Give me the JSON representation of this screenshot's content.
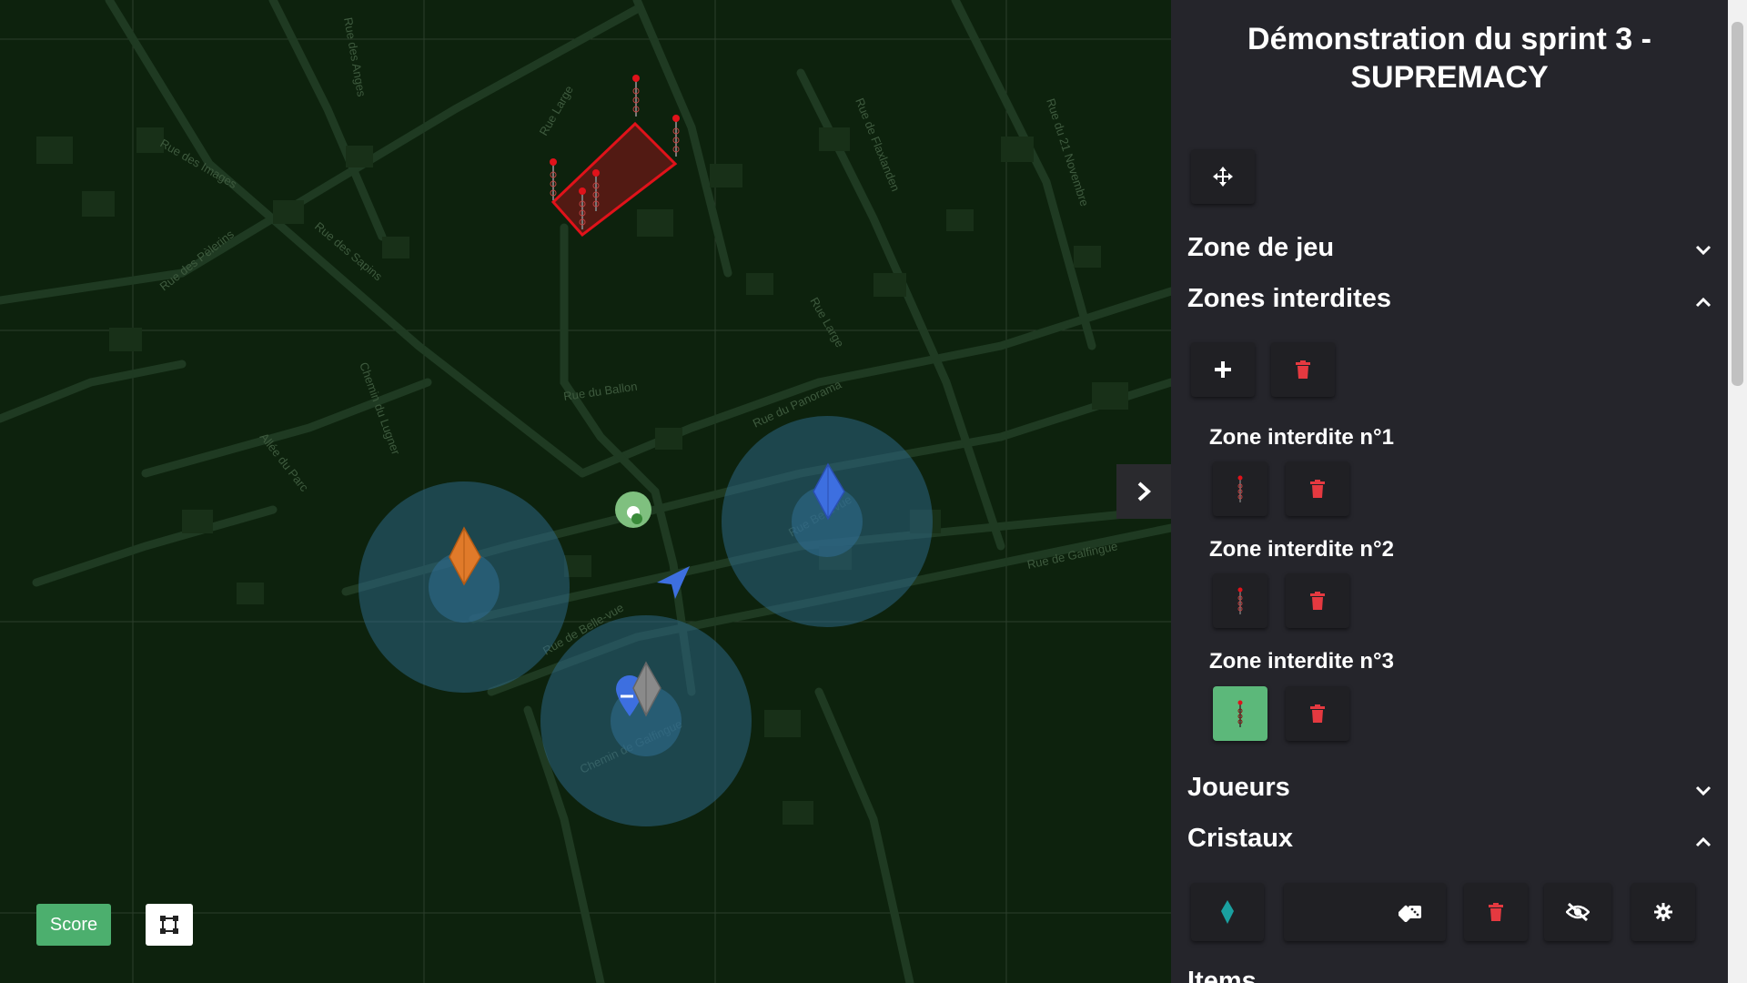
{
  "map": {
    "streets": [
      "Rue des Pèlerins",
      "Rue des Sapins",
      "Rue des Images",
      "Rue Large",
      "Rue du Ballon",
      "Rue du Panorama",
      "Rue de Galfingue",
      "Chemin de Galfingue",
      "Rue de Belle-vue",
      "Rue Bellevue",
      "Chemin du Lugner",
      "Allée du Parc",
      "Rue du Panorama",
      "Rue de Flaxlanden",
      "Rue du 21 Novembre",
      "Rue des Anges",
      "Rue Large"
    ],
    "forbidden_zone_color": "#e0121a",
    "crystal_colors": {
      "orange": "#e07a2a",
      "blue": "#3d6fe0",
      "gray": "#8a8a8a"
    },
    "score_label": "Score",
    "icons": {
      "frame": "vector-square-icon",
      "collapse": "chevron-right-icon",
      "player": "navigation-arrow-icon",
      "base": "green-circle-marker"
    }
  },
  "panel": {
    "title": "Démonstration du sprint 3 - SUPREMACY",
    "move_icon": "arrows-move-icon",
    "sections": {
      "zone_de_jeu": "Zone de jeu",
      "zones_interdites": "Zones interdites",
      "joueurs": "Joueurs",
      "cristaux": "Cristaux",
      "items": "Items"
    },
    "zones": [
      {
        "label": "Zone interdite n°1",
        "active": false
      },
      {
        "label": "Zone interdite n°2",
        "active": false
      },
      {
        "label": "Zone interdite n°3",
        "active": true
      }
    ],
    "colors": {
      "delete": "#e53940",
      "active": "#5cb87a",
      "panel_bg": "#25252b"
    }
  }
}
